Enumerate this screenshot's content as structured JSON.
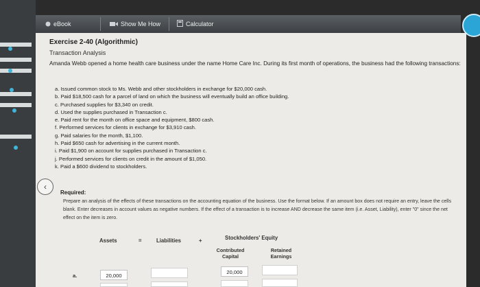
{
  "toolbar": {
    "ebook_label": "eBook",
    "show_me_how_label": "Show Me How",
    "calculator_label": "Calculator"
  },
  "exercise": {
    "title": "Exercise 2-40 (Algorithmic)",
    "subtitle": "Transaction Analysis",
    "intro": "Amanda Webb opened a home health care business under the name Home Care Inc. During its first month of operations, the business had the following transactions:",
    "transactions": [
      "a. Issued common stock to Ms. Webb and other stockholders in exchange for $20,000 cash.",
      "b. Paid $18,500 cash for a parcel of land on which the business will eventually build an office building.",
      "c. Purchased supplies for $3,340 on credit.",
      "d. Used the supplies purchased in Transaction c.",
      "e. Paid rent for the month on office space and equipment, $800 cash.",
      "f. Performed services for clients in exchange for $3,910 cash.",
      "g. Paid salaries for the month, $1,100.",
      "h. Paid $650 cash for advertising in the current month.",
      "i. Paid $1,900 on account for supplies purchased in Transaction c.",
      "j. Performed services for clients on credit in the amount of $1,050.",
      "k. Paid a $600 dividend to stockholders."
    ],
    "required_label": "Required:",
    "instructions": "Prepare an analysis of the effects of these transactions on the accounting equation of the business. Use the format below. If an amount box does not require an entry, leave the cells blank. Enter decreases in account values as negative numbers. If the effect of a transaction is to increase AND decrease the same item (i.e. Asset, Liability), enter \"0\" since the net effect on the item is zero."
  },
  "equation": {
    "assets": "Assets",
    "equals": "=",
    "liabilities": "Liabilities",
    "plus": "+",
    "equity": "Stockholders' Equity",
    "contributed_capital": "Contributed Capital",
    "retained_earnings": "Retained Earnings"
  },
  "rows": [
    {
      "label": "a.",
      "assets": "20,000",
      "liabilities": "",
      "contributed_capital": "20,000",
      "retained_earnings": ""
    }
  ],
  "colors": {
    "accent": "#2ba4d6",
    "page_bg": "#ecebe7",
    "toolbar": "#4a4f52"
  }
}
